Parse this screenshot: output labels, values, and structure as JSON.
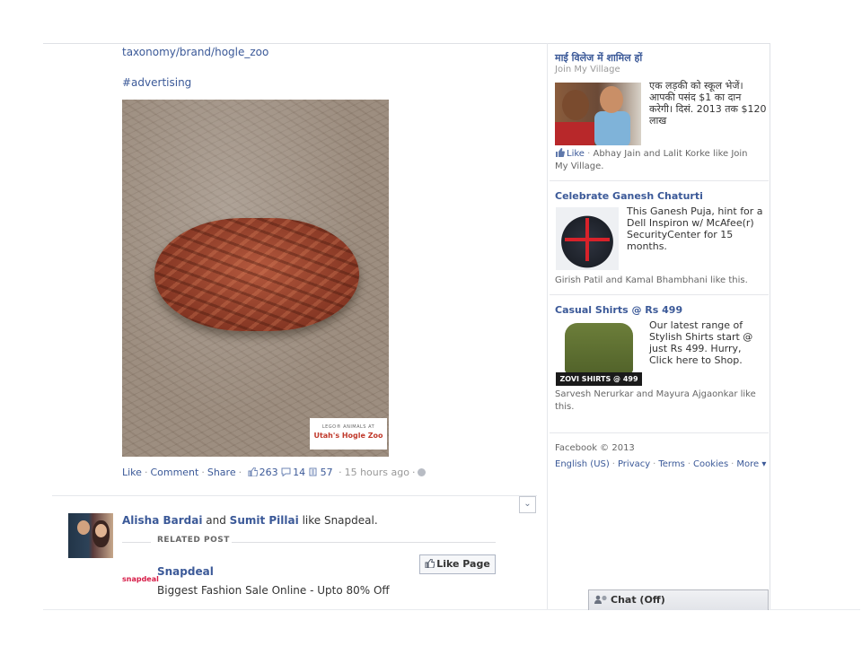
{
  "post": {
    "link_text": "taxonomy/brand/hogle_zoo",
    "hashtag": "#advertising",
    "ad_logo_small": "LEGO® ANIMALS AT",
    "ad_logo_main": "Utah's Hogle Zoo",
    "actions": {
      "like": "Like",
      "comment": "Comment",
      "share": "Share",
      "likes_count": "263",
      "comments_count": "14",
      "shares_count": "57",
      "time": "15 hours ago"
    }
  },
  "story": {
    "person1": "Alisha Bardai",
    "conjunction": "and",
    "person2": "Sumit Pillai",
    "action": "like Snapdeal.",
    "related_label": "RELATED POST",
    "page_name": "Snapdeal",
    "page_logo_text": "snapdeal",
    "page_desc": "Biggest Fashion Sale Online - Upto 80% Off",
    "like_page_label": "Like Page"
  },
  "sidebar": {
    "ads": [
      {
        "title": "माई विलेज में शामिल हों",
        "subtitle": "Join My Village",
        "body": "एक लड़की को स्कूल भेजें। आपकी पसंद $1 का दान करेगी। दिसं. 2013 तक $120 लाख",
        "like_label": "Like",
        "social": "Abhay Jain and Lalit Korke like Join My Village."
      },
      {
        "title": "Celebrate Ganesh Chaturti",
        "body": "This Ganesh Puja, hint for a Dell Inspiron w/ McAfee(r) SecurityCenter for 15 months.",
        "social": "Girish Patil and Kamal Bhambhani like this."
      },
      {
        "title": "Casual Shirts @ Rs 499",
        "body": "Our latest range of Stylish Shirts start @ just Rs 499. Hurry, Click here to Shop.",
        "image_caption": "ZOVI SHIRTS @ 499",
        "social": "Sarvesh Nerurkar and Mayura Ajgaonkar like this."
      }
    ],
    "footer": {
      "copyright": "Facebook © 2013",
      "links": [
        "English (US)",
        "Privacy",
        "Terms",
        "Cookies",
        "More ▾"
      ]
    }
  },
  "chat": {
    "label": "Chat (Off)"
  },
  "colors": {
    "link": "#3b5998",
    "muted": "#999999"
  }
}
